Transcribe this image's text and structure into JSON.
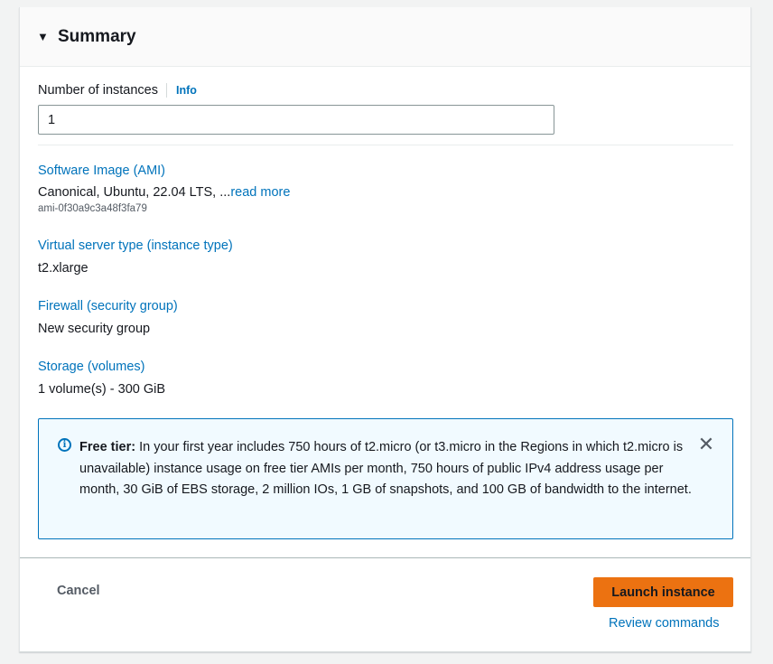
{
  "summary": {
    "title": "Summary",
    "caret_icon": "caret-down-icon"
  },
  "instances": {
    "label": "Number of instances",
    "info_link": "Info",
    "value": "1"
  },
  "fields": [
    {
      "label": "Software Image (AMI)",
      "value": "Canonical, Ubuntu, 22.04 LTS, ...",
      "link": "read more",
      "sub": "ami-0f30a9c3a48f3fa79"
    },
    {
      "label": "Virtual server type (instance type)",
      "value": "t2.xlarge"
    },
    {
      "label": "Firewall (security group)",
      "value": "New security group"
    },
    {
      "label": "Storage (volumes)",
      "value": "1 volume(s) - 300 GiB"
    }
  ],
  "alert": {
    "icon": "info-circle-icon",
    "title": "Free tier:",
    "message": " In your first year includes 750 hours of t2.micro (or t3.micro in the Regions in which t2.micro is unavailable) instance usage on free tier AMIs per month, 750 hours of public IPv4 address usage per month, 30 GiB of EBS storage, 2 million IOs, 1 GB of snapshots, and 100 GB of bandwidth to the internet.",
    "close_icon": "close-icon"
  },
  "footer": {
    "cancel_label": "Cancel",
    "launch_label": "Launch instance",
    "review_label": "Review commands"
  },
  "colors": {
    "link": "#0073bb",
    "primary_button": "#ec7211",
    "alert_background": "#f1faff"
  }
}
